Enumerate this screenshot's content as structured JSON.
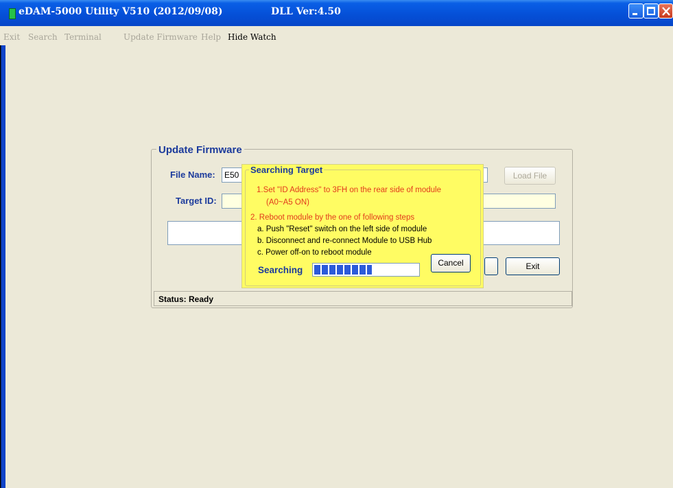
{
  "window": {
    "title": "eDAM-5000 Utility  V510 (2012/09/08)",
    "dll_version": "DLL Ver:4.50",
    "icon": "app-icon",
    "controls": [
      "minimize-icon",
      "maximize-icon",
      "close-icon"
    ]
  },
  "menu": {
    "items": [
      {
        "label": "Exit",
        "enabled": false
      },
      {
        "label": "Search",
        "enabled": false
      },
      {
        "label": "Terminal",
        "enabled": false
      },
      {
        "label": "Update Firmware",
        "enabled": false
      },
      {
        "label": "Help",
        "enabled": false
      },
      {
        "label": "Hide Watch",
        "enabled": true
      }
    ]
  },
  "update_firmware": {
    "title": "Update Firmware",
    "file_name_label": "File Name:",
    "file_name_value": "E50",
    "load_file_button": "Load File",
    "target_id_label": "Target ID:",
    "target_id_value": "",
    "exit_button": "Exit",
    "status": "Status: Ready"
  },
  "searching_dialog": {
    "title": "Searching Target",
    "step1_line1": "1.Set \"ID Address\" to 3FH on the rear side of module",
    "step1_line2": "(A0~A5 ON)",
    "step2": "2. Reboot module by  the one of following steps",
    "step2a": "a. Push \"Reset\" switch on the left side of module",
    "step2b": "b. Disconnect and re-connect Module to USB Hub",
    "step2c": "c. Power off-on to reboot module",
    "searching_label": "Searching",
    "progress_fraction": 0.55,
    "cancel_button": "Cancel"
  },
  "colors": {
    "titlebar": "#0550d8",
    "label_blue": "#1c3b9c",
    "popup_bg": "#fffc63",
    "instruction_red": "#e23a1c",
    "progress_fill": "#2c5bd9"
  }
}
